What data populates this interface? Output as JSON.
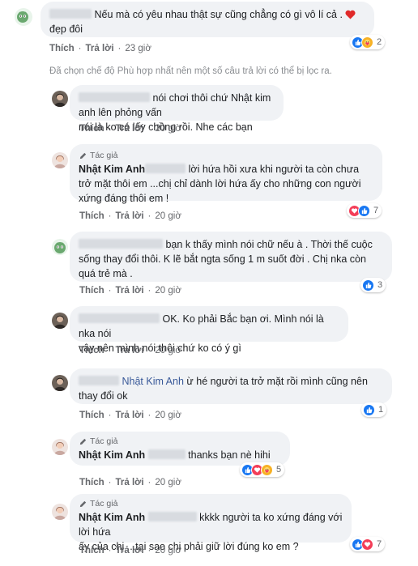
{
  "colors": {
    "bubble": "#f0f2f5",
    "like": "#1877f2",
    "love": "#f33e58",
    "care": "#f7b125",
    "meta": "#65676b"
  },
  "actions": {
    "like": "Thích",
    "reply": "Trả lời"
  },
  "author_badge": "Tác giả",
  "notice": "Đã chọn chế độ Phù hợp nhất nên một số câu trả lời có thể bị lọc ra.",
  "comments": [
    {
      "text": "Nếu mà có yêu nhau thật sự cũng chẳng có gì vô lí cả .",
      "text2": "đẹp đôi",
      "time": "23 giờ",
      "reactions": "2"
    },
    {
      "text": "nói chơi thôi chứ Nhật kim anh lên phỏng vấn",
      "text2": "nói là ko có lấy chồng rồi. Nhe các bạn",
      "time": "20 giờ"
    },
    {
      "name": "Nhật Kim Anh",
      "text": "lời hứa hồi xưa khi người ta còn chưa",
      "text2": "trở mặt thôi em ...chị chỉ dành lời hứa ấy cho những con người",
      "text3": "xứng đáng thôi em !",
      "time": "20 giờ",
      "reactions": "7"
    },
    {
      "text": "bạn k thấy mình nói chữ nếu à . Thời thế cuộc",
      "text2": "sống thay đổi thôi. K lẽ bắt ngta sống 1 m suốt đời . Chị nka còn",
      "text3": "quá trẻ mà .",
      "time": "20 giờ",
      "reactions": "3"
    },
    {
      "text": "OK. Ko phải Bắc bạn ơi. Mình nói là nka nói",
      "text2": "vậy nên mình nói thôi chứ ko có ý gì",
      "time": "20 giờ"
    },
    {
      "name": "Nhật Kim Anh",
      "text": "ừ hé người ta trở mặt rồi mình cũng nên",
      "text2": "thay đổi ok",
      "time": "20 giờ",
      "reactions": "1"
    },
    {
      "name": "Nhật Kim Anh",
      "text": "thanks bạn nè hihi",
      "time": "20 giờ",
      "reactions": "5"
    },
    {
      "name": "Nhật Kim Anh",
      "text": "kkkk người ta ko xứng đáng với lời hứa",
      "text2": "ấy của chị ...tại sao chị phải giữ lời đúng ko em ?",
      "time": "20 giờ",
      "reactions": "7"
    }
  ]
}
